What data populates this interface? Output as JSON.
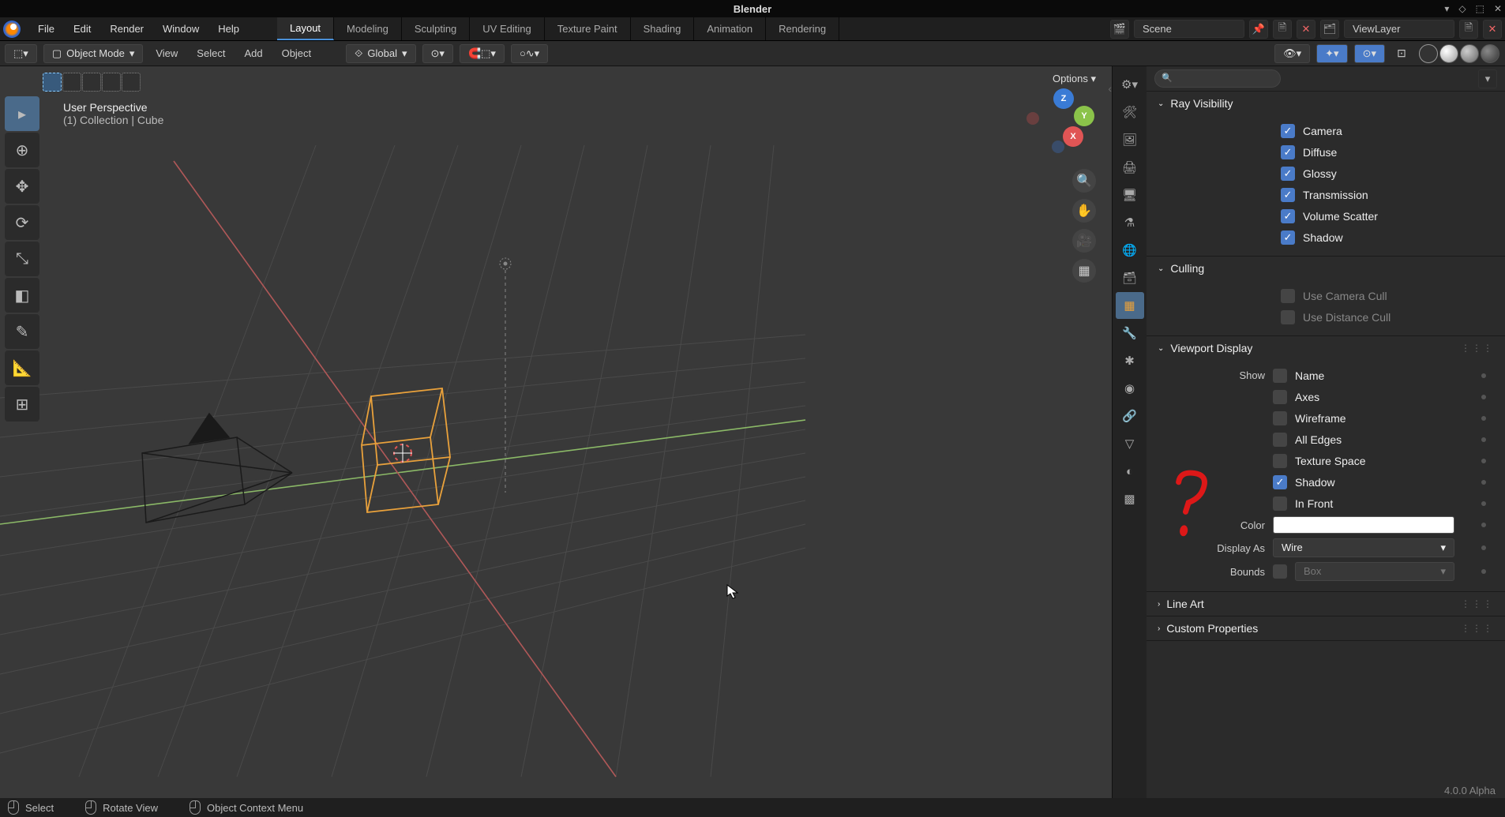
{
  "titlebar": {
    "title": "Blender"
  },
  "topmenu": {
    "items": [
      "File",
      "Edit",
      "Render",
      "Window",
      "Help"
    ],
    "workspaces": [
      "Layout",
      "Modeling",
      "Sculpting",
      "UV Editing",
      "Texture Paint",
      "Shading",
      "Animation",
      "Rendering"
    ],
    "active_workspace": "Layout",
    "scene_name": "Scene",
    "viewlayer_name": "ViewLayer"
  },
  "toolheader": {
    "mode": "Object Mode",
    "menus": [
      "View",
      "Select",
      "Add",
      "Object"
    ],
    "orientation": "Global",
    "options_label": "Options"
  },
  "viewport": {
    "header_line1": "User Perspective",
    "header_line2": "(1) Collection | Cube",
    "gizmo": {
      "z": "Z",
      "y": "Y",
      "x": "X"
    }
  },
  "properties": {
    "sections": {
      "ray_visibility": {
        "title": "Ray Visibility",
        "items": [
          {
            "label": "Camera",
            "checked": true
          },
          {
            "label": "Diffuse",
            "checked": true
          },
          {
            "label": "Glossy",
            "checked": true
          },
          {
            "label": "Transmission",
            "checked": true
          },
          {
            "label": "Volume Scatter",
            "checked": true
          },
          {
            "label": "Shadow",
            "checked": true
          }
        ]
      },
      "culling": {
        "title": "Culling",
        "items": [
          {
            "label": "Use Camera Cull",
            "checked": false
          },
          {
            "label": "Use Distance Cull",
            "checked": false
          }
        ]
      },
      "viewport_display": {
        "title": "Viewport Display",
        "show_label": "Show",
        "items": [
          {
            "label": "Name",
            "checked": false
          },
          {
            "label": "Axes",
            "checked": false
          },
          {
            "label": "Wireframe",
            "checked": false
          },
          {
            "label": "All Edges",
            "checked": false
          },
          {
            "label": "Texture Space",
            "checked": false
          },
          {
            "label": "Shadow",
            "checked": true
          },
          {
            "label": "In Front",
            "checked": false
          }
        ],
        "color_label": "Color",
        "color_value": "#FFFFFF",
        "display_as_label": "Display As",
        "display_as_value": "Wire",
        "bounds_label": "Bounds",
        "bounds_value": "Box",
        "bounds_checked": false
      },
      "line_art": {
        "title": "Line Art"
      },
      "custom_properties": {
        "title": "Custom Properties"
      }
    }
  },
  "statusbar": {
    "select": "Select",
    "rotate": "Rotate View",
    "context": "Object Context Menu",
    "version": "4.0.0 Alpha"
  }
}
